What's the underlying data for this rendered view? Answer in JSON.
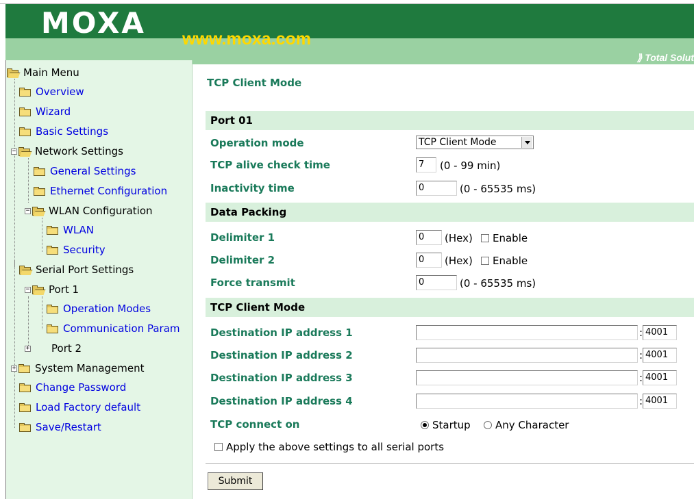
{
  "header": {
    "logo_text": "MOXA",
    "url": "www.moxa.com",
    "slogan": "⟫ Total Solut"
  },
  "sidebar": {
    "items": [
      {
        "label": "Main Menu",
        "link": false
      },
      {
        "label": "Overview",
        "link": true
      },
      {
        "label": "Wizard",
        "link": true
      },
      {
        "label": "Basic Settings",
        "link": true
      },
      {
        "label": "Network Settings",
        "link": false
      },
      {
        "label": "General Settings",
        "link": true
      },
      {
        "label": "Ethernet Configuration",
        "link": true
      },
      {
        "label": "WLAN Configuration",
        "link": false
      },
      {
        "label": "WLAN",
        "link": true
      },
      {
        "label": "Security",
        "link": true
      },
      {
        "label": "Serial Port Settings",
        "link": false
      },
      {
        "label": "Port 1",
        "link": false
      },
      {
        "label": "Operation Modes",
        "link": true
      },
      {
        "label": "Communication Param",
        "link": true
      },
      {
        "label": "Port 2",
        "link": false
      },
      {
        "label": "System Management",
        "link": false
      },
      {
        "label": "Change Password",
        "link": true
      },
      {
        "label": "Load Factory default",
        "link": true
      },
      {
        "label": "Save/Restart",
        "link": true
      }
    ]
  },
  "main": {
    "title": "TCP Client Mode",
    "sections": {
      "port": "Port 01",
      "data_packing": "Data Packing",
      "tcp_client": "TCP Client Mode"
    },
    "fields": {
      "operation_mode": {
        "label": "Operation mode",
        "value": "TCP Client Mode"
      },
      "tcp_alive": {
        "label": "TCP alive check time",
        "value": "7",
        "hint": "(0 - 99 min)"
      },
      "inactivity": {
        "label": "Inactivity time",
        "value": "0",
        "hint": "(0 - 65535 ms)"
      },
      "delimiter1": {
        "label": "Delimiter 1",
        "value": "0",
        "hint": "(Hex)",
        "enable": "Enable"
      },
      "delimiter2": {
        "label": "Delimiter 2",
        "value": "0",
        "hint": "(Hex)",
        "enable": "Enable"
      },
      "force_transmit": {
        "label": "Force transmit",
        "value": "0",
        "hint": "(0 - 65535 ms)"
      },
      "dest1": {
        "label": "Destination IP address 1",
        "ip": "",
        "port": "4001"
      },
      "dest2": {
        "label": "Destination IP address 2",
        "ip": "",
        "port": "4001"
      },
      "dest3": {
        "label": "Destination IP address 3",
        "ip": "",
        "port": "4001"
      },
      "dest4": {
        "label": "Destination IP address 4",
        "ip": "",
        "port": "4001"
      },
      "connect_on": {
        "label": "TCP connect on",
        "option1": "Startup",
        "option2": "Any Character",
        "selected": "Startup"
      }
    },
    "apply_all": "Apply the above settings to all serial ports",
    "colon": ":",
    "submit": "Submit"
  },
  "colors": {
    "header_dark": "#1f7a3e",
    "header_light": "#9ad1a2",
    "url_yellow": "#ffd800",
    "sidebar_bg": "#e4f6e6",
    "section_bg": "#d8f0dc",
    "label_green": "#1a7a5a",
    "link_blue": "#0000e0"
  }
}
